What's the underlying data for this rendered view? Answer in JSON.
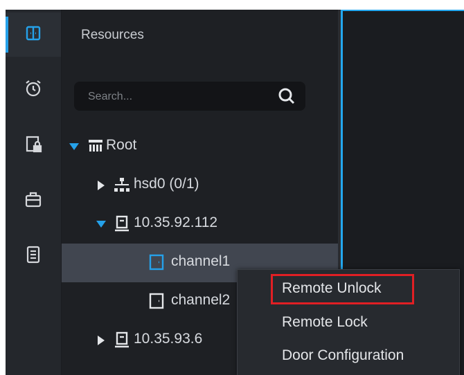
{
  "sidebar": {
    "items": [
      {
        "icon": "door-access-icon",
        "active": true
      },
      {
        "icon": "alarm-clock-icon"
      },
      {
        "icon": "locked-door-icon"
      },
      {
        "icon": "toolbox-icon"
      },
      {
        "icon": "log-list-icon"
      }
    ]
  },
  "resources": {
    "title": "Resources",
    "search_placeholder": "Search...",
    "tree": [
      {
        "label": "Root",
        "icon": "organization-icon",
        "expanded": true
      },
      {
        "label": "hsd0 (0/1)",
        "icon": "network-icon",
        "expanded": false
      },
      {
        "label": "10.35.92.112",
        "icon": "access-controller-icon",
        "expanded": true
      },
      {
        "label": "channel1",
        "icon": "door-channel-icon",
        "selected": true
      },
      {
        "label": "channel2",
        "icon": "door-channel-icon"
      },
      {
        "label": "10.35.93.6",
        "icon": "access-controller-icon",
        "expanded": false
      }
    ]
  },
  "context_menu": {
    "items": [
      "Remote Unlock",
      "Remote Lock",
      "Door Configuration"
    ],
    "highlighted": "Remote Unlock"
  },
  "colors": {
    "accent": "#25a1ea",
    "highlight_border": "#e11f24",
    "background": "#1b1d21"
  }
}
